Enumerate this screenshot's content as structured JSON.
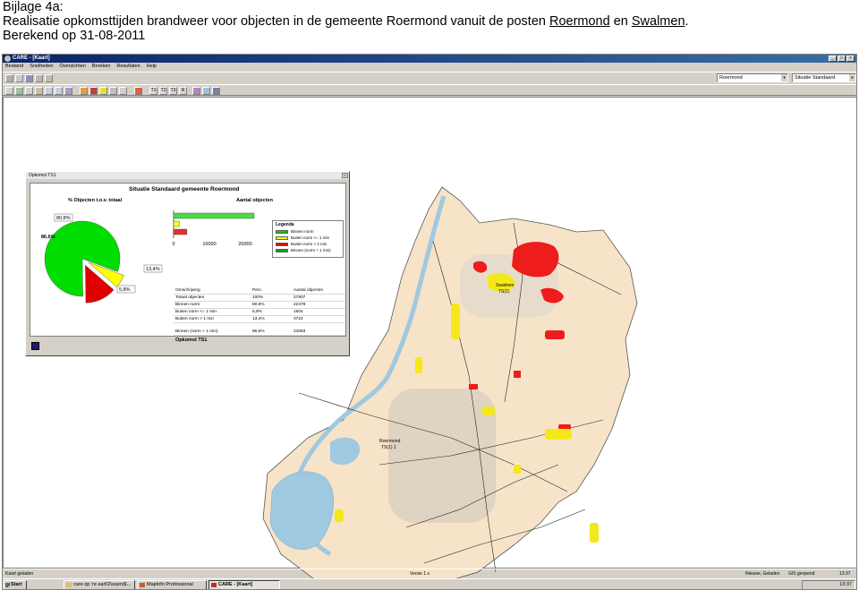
{
  "document": {
    "heading": "Bijlage 4a:",
    "line2_prefix": "Realisatie opkomsttijden brandweer voor objecten in de gemeente Roermond vanuit de posten ",
    "post1": "Roermond",
    "line2_join": " en ",
    "post2": "Swalmen",
    "line2_end": ".",
    "computed": "Berekend op 31-08-2011"
  },
  "window": {
    "title": "CARE - [Kaart]",
    "controls": [
      "_",
      "□",
      "×"
    ]
  },
  "menu": [
    "Bestand",
    "Snelheden",
    "Overzichten",
    "Bereken",
    "Resultaten",
    "Help"
  ],
  "toolbar": {
    "area_select": "Roermond",
    "situation_select": "Situatie Standaard",
    "buttons_row2": [
      "T1",
      "T2",
      "T3",
      "R"
    ]
  },
  "chart_window": {
    "title": "Opkomst TS1",
    "panel_title": "Situatie Standaard gemeente Roermond",
    "left_label": "% Objecten t.o.v. totaal",
    "right_label": "Aantal objecten",
    "footer_label": "Opkomst TS1",
    "table": {
      "headers": [
        "Omschrijving",
        "Perc.",
        "Aantal objecten"
      ],
      "rows": [
        [
          "Totaal objecten",
          "100%",
          "27807"
        ],
        [
          "Binnen norm",
          "80,8%",
          "22479"
        ],
        [
          "Buiten norm <= 1 min",
          "5,8%",
          "1604"
        ],
        [
          "Buiten norm > 1 min",
          "13,4%",
          "3724"
        ]
      ],
      "summary": [
        "Binnen (norm + 1 min)",
        "86,6%",
        "24083"
      ]
    },
    "legend": {
      "title": "Legenda",
      "items": [
        {
          "label": "Binnen norm",
          "color": "#00cc00"
        },
        {
          "label": "Buiten norm <= 1 min",
          "color": "#ffff00"
        },
        {
          "label": "Buiten norm > 1 min",
          "color": "#e00000"
        },
        {
          "label": "Binnen (norm + 1 min)",
          "color": "#00aa00"
        }
      ]
    }
  },
  "chart_data": [
    {
      "type": "pie",
      "labels": [
        "Binnen norm",
        "Buiten norm <= 1 min",
        "Buiten norm > 1 min"
      ],
      "values": [
        80.8,
        5.8,
        13.4
      ],
      "slice_labels": [
        "80,8%",
        "5,8%",
        "13,4%"
      ],
      "ring_value": 86.6,
      "ring_label": "86,6%",
      "colors": [
        "#00dd00",
        "#ffff00",
        "#e00000"
      ],
      "ring_color": "#22bb22"
    },
    {
      "type": "bar",
      "orientation": "horizontal",
      "categories": [
        "Binnen norm",
        "Buiten norm <= 1 min",
        "Buiten norm > 1 min"
      ],
      "values": [
        22479,
        1604,
        3724
      ],
      "colors": [
        "#44dd44",
        "#ffff00",
        "#e03030"
      ],
      "xlim": [
        0,
        30000
      ],
      "ticks": [
        "0",
        "10000",
        "20000",
        "30000"
      ],
      "grid": false
    }
  ],
  "map": {
    "labels": [
      "Swalmen",
      "TS(1)",
      "Roermond",
      "TS(1) 1"
    ]
  },
  "status": {
    "left": "Kaart geladen",
    "version": "Versie 1.x",
    "mode": "Nieuwe, Geladen",
    "gis": "GIS geopend",
    "clock_left": "13:37"
  },
  "taskbar": {
    "start": "Start",
    "tasks": [
      "care op 'nr-sar02\\users$...",
      "MapInfo Professional",
      "CARE - [Kaart]"
    ],
    "clock": "13:37"
  }
}
